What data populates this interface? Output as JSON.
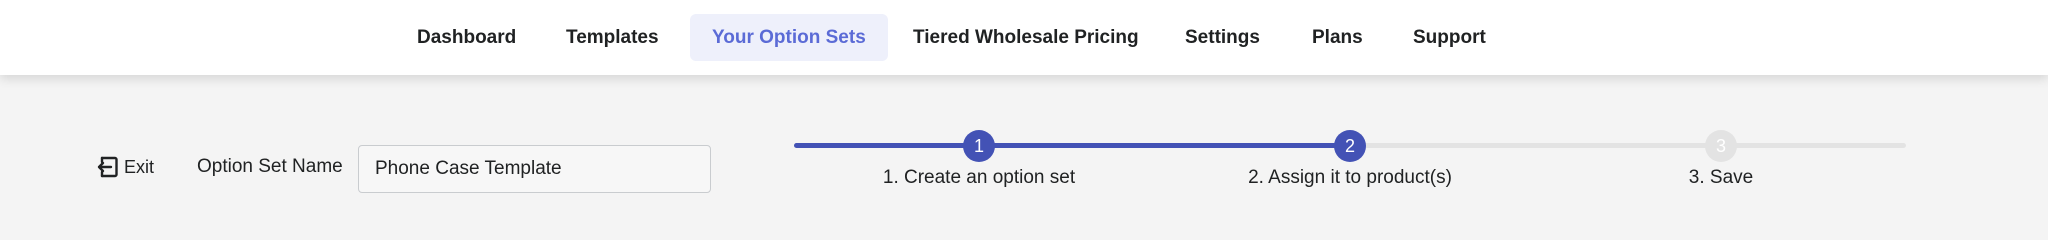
{
  "nav": {
    "items": [
      {
        "label": "Dashboard",
        "active": false
      },
      {
        "label": "Templates",
        "active": false
      },
      {
        "label": "Your Option Sets",
        "active": true
      },
      {
        "label": "Tiered Wholesale Pricing",
        "active": false
      },
      {
        "label": "Settings",
        "active": false
      },
      {
        "label": "Plans",
        "active": false
      },
      {
        "label": "Support",
        "active": false
      }
    ]
  },
  "toolbar": {
    "exit_label": "Exit",
    "exit_icon": "exit-icon",
    "option_set_name_label": "Option Set Name",
    "option_set_name_value": "Phone Case Template"
  },
  "stepper": {
    "current_step": 2,
    "steps": [
      {
        "number": "1",
        "label": "1. Create an option set",
        "status": "complete"
      },
      {
        "number": "2",
        "label": "2. Assign it to product(s)",
        "status": "current"
      },
      {
        "number": "3",
        "label": "3. Save",
        "status": "upcoming"
      }
    ]
  },
  "colors": {
    "accent": "#4352b5",
    "active_nav_bg": "#eef0fb",
    "active_nav_text": "#5b6bd6",
    "inactive_track": "#e3e3e3"
  }
}
